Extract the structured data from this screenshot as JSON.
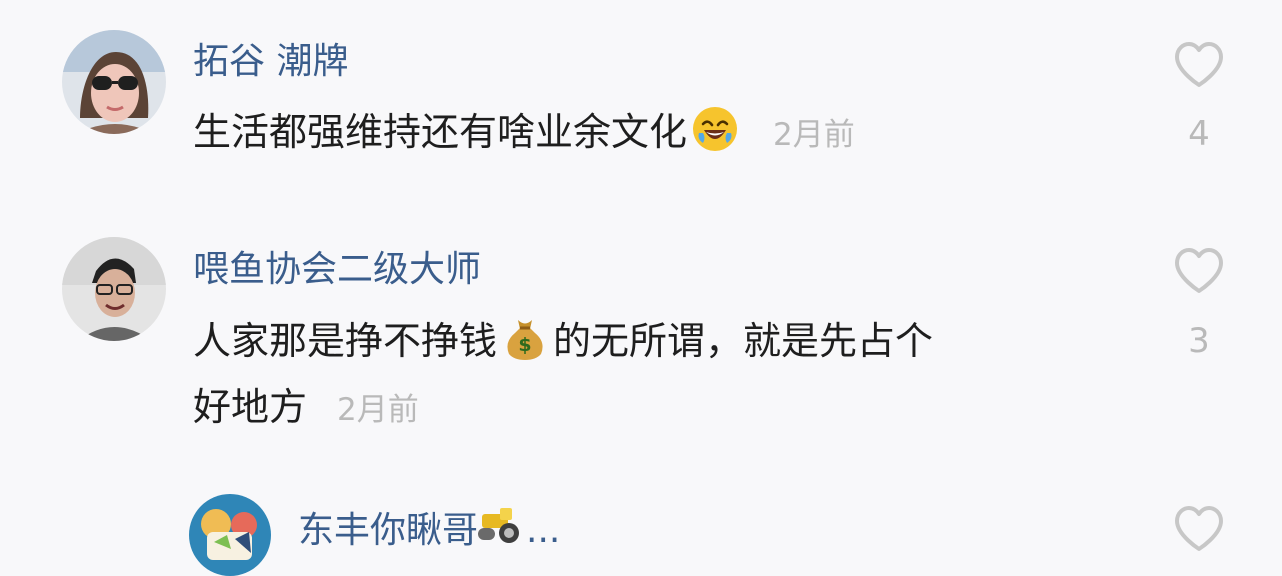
{
  "comments": [
    {
      "username": "拓谷 潮牌",
      "text_before": "生活都强维持还有啥业余文化",
      "emoji": "crying-laughing-emoji",
      "time": "2月前",
      "likes": "4"
    },
    {
      "username": "喂鱼协会二级大师",
      "line1_before": "人家那是挣不挣钱",
      "emoji": "money-bag-emoji",
      "line1_after": "的无所谓，就是先占个",
      "line2": "好地方",
      "time": "2月前",
      "likes": "3"
    },
    {
      "username": "东丰你瞅哥",
      "suffix": "...",
      "emoji": "road-roller-emoji"
    }
  ],
  "colors": {
    "background": "#f8f8fa",
    "username": "#3a5d8c",
    "text": "#1e1e1e",
    "muted": "#b9b9b9"
  },
  "icons": {
    "like": "heart-outline-icon"
  }
}
